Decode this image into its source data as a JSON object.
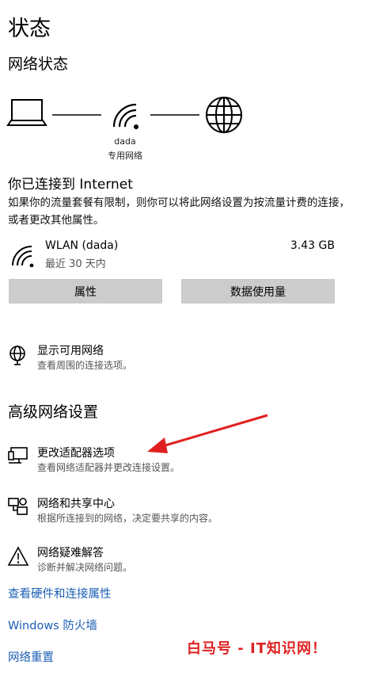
{
  "page": {
    "title": "状态"
  },
  "network_status": {
    "heading": "网络状态",
    "network_name": "dada",
    "network_type": "专用网络"
  },
  "connection": {
    "title": "你已连接到 Internet",
    "description": "如果你的流量套餐有限制，则你可以将此网络设置为按流量计费的连接，或者更改其他属性。",
    "adapter_name": "WLAN (dada)",
    "period": "最近 30 天内",
    "usage": "3.43 GB"
  },
  "buttons": {
    "properties": "属性",
    "data_usage": "数据使用量"
  },
  "show_networks": {
    "title": "显示可用网络",
    "subtitle": "查看周围的连接选项。"
  },
  "advanced": {
    "heading": "高级网络设置",
    "items": [
      {
        "title": "更改适配器选项",
        "subtitle": "查看网络适配器并更改连接设置。"
      },
      {
        "title": "网络和共享中心",
        "subtitle": "根据所连接到的网络，决定要共享的内容。"
      },
      {
        "title": "网络疑难解答",
        "subtitle": "诊断并解决网络问题。"
      }
    ]
  },
  "links": [
    "查看硬件和连接属性",
    "Windows 防火墙",
    "网络重置"
  ],
  "watermark": "白马号 - IT知识网！",
  "colors": {
    "link": "#1a5fb4",
    "button_bg": "#cccccc",
    "arrow": "#e02020"
  },
  "icons": [
    "laptop-icon",
    "wifi-icon",
    "globe-icon",
    "network-list-icon",
    "adapter-icon",
    "sharing-center-icon",
    "warning-icon"
  ]
}
